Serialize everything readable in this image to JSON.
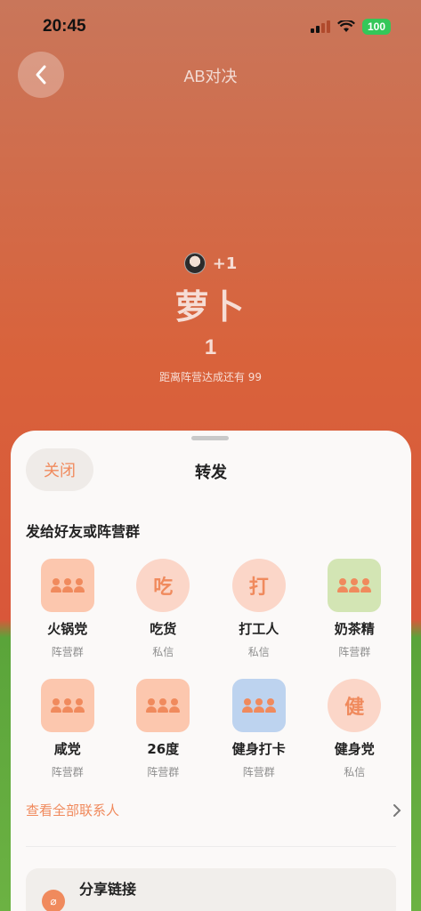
{
  "status": {
    "time": "20:45",
    "battery": "100"
  },
  "nav": {
    "title": "AB对决"
  },
  "hero": {
    "plus": "+1",
    "team_name": "萝卜",
    "count": "1",
    "remaining_text": "距离阵营达成还有 99"
  },
  "sheet": {
    "close_label": "关闭",
    "title": "转发",
    "section_title": "发给好友或阵营群",
    "contacts": [
      {
        "name": "火锅党",
        "type": "阵营群",
        "icon": "group-icon",
        "bg": "#fcc7ae",
        "fg": "#f08a5d",
        "char": ""
      },
      {
        "name": "吃货",
        "type": "私信",
        "icon": "char-avatar",
        "bg": "#fbd6c8",
        "fg": "#f08a5d",
        "char": "吃"
      },
      {
        "name": "打工人",
        "type": "私信",
        "icon": "char-avatar",
        "bg": "#fbd6c8",
        "fg": "#f08a5d",
        "char": "打"
      },
      {
        "name": "奶茶精",
        "type": "阵营群",
        "icon": "group-icon",
        "bg": "#d3e5b4",
        "fg": "#f08a5d",
        "char": ""
      },
      {
        "name": "咸党",
        "type": "阵营群",
        "icon": "group-icon",
        "bg": "#fcc7ae",
        "fg": "#f08a5d",
        "char": ""
      },
      {
        "name": "26度",
        "type": "阵营群",
        "icon": "group-icon",
        "bg": "#fcc7ae",
        "fg": "#f08a5d",
        "char": ""
      },
      {
        "name": "健身打卡",
        "type": "阵营群",
        "icon": "group-icon",
        "bg": "#bdd3ef",
        "fg": "#f08a5d",
        "char": ""
      },
      {
        "name": "健身党",
        "type": "私信",
        "icon": "char-avatar",
        "bg": "#fbd6c8",
        "fg": "#f08a5d",
        "char": "健"
      }
    ],
    "view_all_label": "查看全部联系人",
    "share_link_label": "分享链接"
  }
}
